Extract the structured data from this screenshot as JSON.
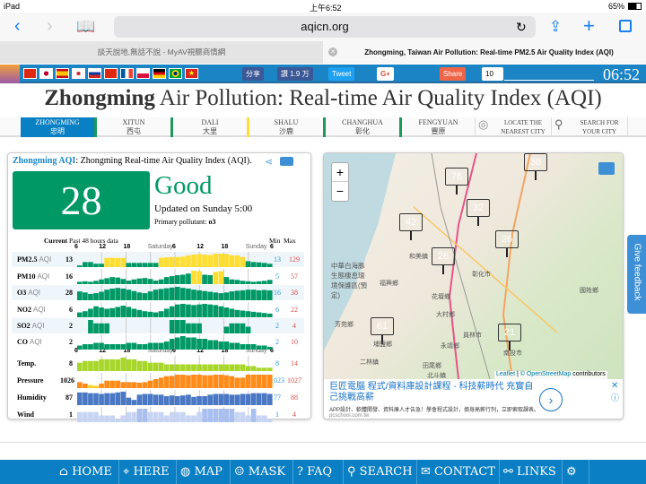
{
  "status": {
    "device": "iPad",
    "time": "上午6:52",
    "battery": "65%"
  },
  "browser": {
    "url": "aqicn.org",
    "tabs": [
      {
        "label": "談天說地,無話不說 - MyAV視聽商情網"
      },
      {
        "label": "Zhongming, Taiwan Air Pollution: Real-time PM2.5 Air Quality Index (AQI)"
      }
    ]
  },
  "topbar": {
    "share_fb": "分享",
    "like": "讚 1.9 万",
    "tweet": "Tweet",
    "gplus": "G+",
    "share": "Share",
    "share_count": "10",
    "clock": "06:52"
  },
  "page_title_bold": "Zhongming",
  "page_title_rest": " Air Pollution: Real-time Air Quality Index (AQI)",
  "cities": [
    {
      "en": "Zhongming",
      "zh": "忠明",
      "color": "#009966"
    },
    {
      "en": "Xitun",
      "zh": "西屯",
      "color": "#009966"
    },
    {
      "en": "Dali",
      "zh": "大里",
      "color": "#009966"
    },
    {
      "en": "Shalu",
      "zh": "沙鹿",
      "color": "#ffde33"
    },
    {
      "en": "Changhua",
      "zh": "彰化",
      "color": "#009966"
    },
    {
      "en": "Fengyuan",
      "zh": "豐原",
      "color": "#009966"
    }
  ],
  "locate": "LOCATE THE NEAREST CITY",
  "search_city": "SEARCH FOR YOUR CITY",
  "aqi": {
    "heading": "Zhongming AQI",
    "subheading": ": Zhongming Real-time Air Quality Index (AQI).",
    "value": "28",
    "level": "Good",
    "updated": "Updated on Sunday 5:00",
    "primary_label": "Primary pollutant: ",
    "primary": "o3",
    "level_color": "#009966",
    "hdr_current": "Current",
    "hdr_past": "Past 48 hours data",
    "hdr_min": "Min",
    "hdr_max": "Max",
    "ticks": [
      "6",
      "12",
      "18",
      "Saturday",
      "6",
      "12",
      "18",
      "Sunday",
      "6"
    ],
    "rows": [
      {
        "name": "PM2.5",
        "unit": "AQI",
        "cur": "13",
        "min": "13",
        "max": "129",
        "type": "aqi",
        "values": [
          10,
          30,
          30,
          20,
          20,
          55,
          55,
          55,
          55,
          25,
          25,
          25,
          25,
          25,
          25,
          55,
          58,
          60,
          60,
          62,
          70,
          75,
          78,
          75,
          72,
          80,
          80,
          78,
          70,
          70,
          60,
          35,
          30,
          28,
          25,
          20
        ]
      },
      {
        "name": "PM10",
        "unit": "AQI",
        "cur": "16",
        "min": "5",
        "max": "57",
        "type": "aqi",
        "values": [
          10,
          12,
          10,
          14,
          20,
          25,
          30,
          28,
          22,
          15,
          20,
          24,
          26,
          22,
          15,
          20,
          30,
          34,
          38,
          40,
          45,
          57,
          55,
          40,
          38,
          52,
          55,
          30,
          20,
          18,
          14,
          12,
          10,
          12,
          14,
          18
        ]
      },
      {
        "name": "O3",
        "unit": "AQI",
        "cur": "28",
        "min": "16",
        "max": "38",
        "type": "aqi",
        "values": [
          25,
          22,
          18,
          20,
          24,
          30,
          33,
          35,
          33,
          30,
          26,
          22,
          20,
          25,
          30,
          32,
          34,
          36,
          38,
          35,
          33,
          30,
          28,
          26,
          24,
          22,
          20,
          22,
          25,
          27,
          28,
          30,
          30,
          28,
          29,
          28
        ]
      },
      {
        "name": "NO2",
        "unit": "AQI",
        "cur": "6",
        "min": "6",
        "max": "22",
        "type": "aqi",
        "values": [
          8,
          10,
          14,
          18,
          16,
          14,
          15,
          17,
          19,
          17,
          14,
          12,
          10,
          9,
          8,
          10,
          14,
          18,
          21,
          22,
          21,
          20,
          21,
          22,
          21,
          20,
          18,
          16,
          14,
          12,
          11,
          10,
          9,
          8,
          7,
          6
        ]
      },
      {
        "name": "SO2",
        "unit": "AQI",
        "cur": "2",
        "min": "2",
        "max": "4",
        "type": "aqi",
        "values": [
          0,
          0,
          4,
          3,
          3,
          3,
          0,
          0,
          0,
          0,
          0,
          0,
          0,
          0,
          0,
          0,
          0,
          4,
          4,
          4,
          3,
          3,
          3,
          0,
          0,
          0,
          0,
          2,
          3,
          3,
          3,
          2,
          0,
          0,
          0,
          0
        ]
      },
      {
        "name": "CO",
        "unit": "AQI",
        "cur": "2",
        "min": "2",
        "max": "10",
        "type": "aqi",
        "values": [
          3,
          4,
          4,
          5,
          5,
          4,
          4,
          4,
          4,
          5,
          5,
          4,
          4,
          5,
          5,
          5,
          6,
          8,
          9,
          10,
          9,
          9,
          8,
          8,
          7,
          7,
          6,
          6,
          5,
          5,
          4,
          4,
          4,
          3,
          3,
          2
        ]
      },
      {
        "name": "Temp.",
        "unit": "",
        "cur": "8",
        "min": "8",
        "max": "14",
        "type": "temp",
        "values": [
          11,
          12,
          12,
          12,
          13,
          13,
          13,
          13,
          14,
          13,
          13,
          12,
          12,
          11,
          11,
          11,
          10,
          10,
          10,
          10,
          10,
          10,
          10,
          10,
          10,
          10,
          10,
          10,
          10,
          10,
          10,
          9,
          9,
          8,
          8,
          8
        ]
      },
      {
        "name": "Pressure",
        "unit": "",
        "cur": "1026",
        "min": "1023",
        "max": "1027",
        "type": "press",
        "values": [
          1024.5,
          1024,
          1023.5,
          1023.3,
          1024,
          1025,
          1025,
          1025,
          1024.5,
          1024.5,
          1024.5,
          1024.3,
          1024.5,
          1025,
          1025.5,
          1026,
          1026.5,
          1026.6,
          1027,
          1027,
          1026.8,
          1027,
          1027,
          1026.8,
          1026.8,
          1027,
          1027,
          1026.8,
          1026.5,
          1026,
          1026,
          1027,
          1027,
          1027,
          1027,
          1027
        ]
      },
      {
        "name": "Humidity",
        "unit": "",
        "cur": "87",
        "min": "77",
        "max": "88",
        "type": "hum",
        "values": [
          87,
          87,
          86,
          86,
          85,
          86,
          86,
          87,
          88,
          80,
          77,
          84,
          85,
          85,
          84,
          84,
          82,
          83,
          82,
          83,
          84,
          81,
          82,
          82,
          84,
          85,
          85,
          85,
          84,
          84,
          85,
          85,
          86,
          86,
          86,
          85
        ]
      },
      {
        "name": "Wind",
        "unit": "",
        "cur": "1",
        "min": "1",
        "max": "4",
        "type": "wind",
        "values": [
          3,
          3,
          3,
          3,
          2,
          2,
          2,
          1,
          2,
          3,
          3,
          4,
          4,
          3,
          3,
          3,
          2,
          3,
          3,
          3,
          2,
          2,
          3,
          4,
          4,
          4,
          4,
          4,
          4,
          3,
          3,
          2,
          4,
          2,
          2,
          1
        ]
      }
    ]
  },
  "map": {
    "markers": [
      {
        "v": "76",
        "c": "#ffde33"
      },
      {
        "v": "38",
        "c": "#009966"
      },
      {
        "v": "42",
        "c": "#009966"
      },
      {
        "v": "32",
        "c": "#009966"
      },
      {
        "v": "26",
        "c": "#009966"
      },
      {
        "v": "26",
        "c": "#009966"
      },
      {
        "v": "61",
        "c": "#ffde33"
      },
      {
        "v": "21",
        "c": "#009966"
      }
    ],
    "zoom_in": "+",
    "zoom_out": "−",
    "attr_leaflet": "Leaflet",
    "attr_osm": "© OpenStreetMap",
    "attr_contrib": "contributors",
    "place_labels": [
      "中華白海豚生態棲息環境保護區(預定)",
      "福興鄉",
      "彰化市",
      "花壇鄉",
      "大村鄉",
      "員林市",
      "永靖鄉",
      "田尾鄉",
      "北斗鎮",
      "二林鎮",
      "埔鹽鄉",
      "南投市",
      "國姓鄉",
      "和美鎮",
      "芳苑鄉"
    ]
  },
  "ad": {
    "title": "巨匠電腦 程式/資料庫設計課程 - 科技薪時代 充實自己挑戰高薪",
    "desc": "APP設計、軟體開發、資料庫人才告急！學會程式設計，擠身高薪行列，立即索取課表。",
    "domain": "pcschool.com.tw"
  },
  "feedback": "Give feedback",
  "footer": [
    {
      "label": "HOME",
      "icon": "⌂"
    },
    {
      "label": "HERE",
      "icon": "⌖"
    },
    {
      "label": "MAP",
      "icon": "◍"
    },
    {
      "label": "MASK",
      "icon": "☺"
    },
    {
      "label": "FAQ",
      "icon": "?"
    },
    {
      "label": "SEARCH",
      "icon": "⚲"
    },
    {
      "label": "CONTACT",
      "icon": "✉"
    },
    {
      "label": "LINKS",
      "icon": "⚯"
    }
  ]
}
